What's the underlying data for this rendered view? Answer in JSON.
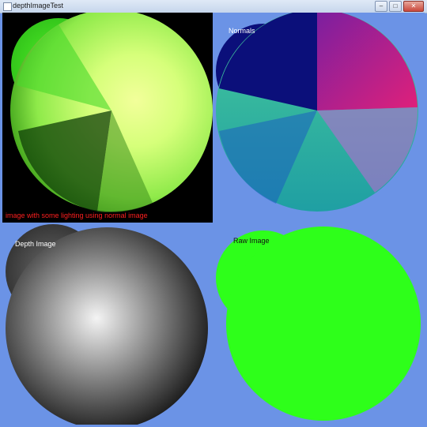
{
  "window": {
    "title": "depthImageTest",
    "minimize_label": "–",
    "maximize_label": "□",
    "close_label": "✕"
  },
  "panels": [
    {
      "label": "image with some lighting using normal image"
    },
    {
      "label": "Normals"
    },
    {
      "label": "Depth Image"
    },
    {
      "label": "Raw Image"
    }
  ]
}
